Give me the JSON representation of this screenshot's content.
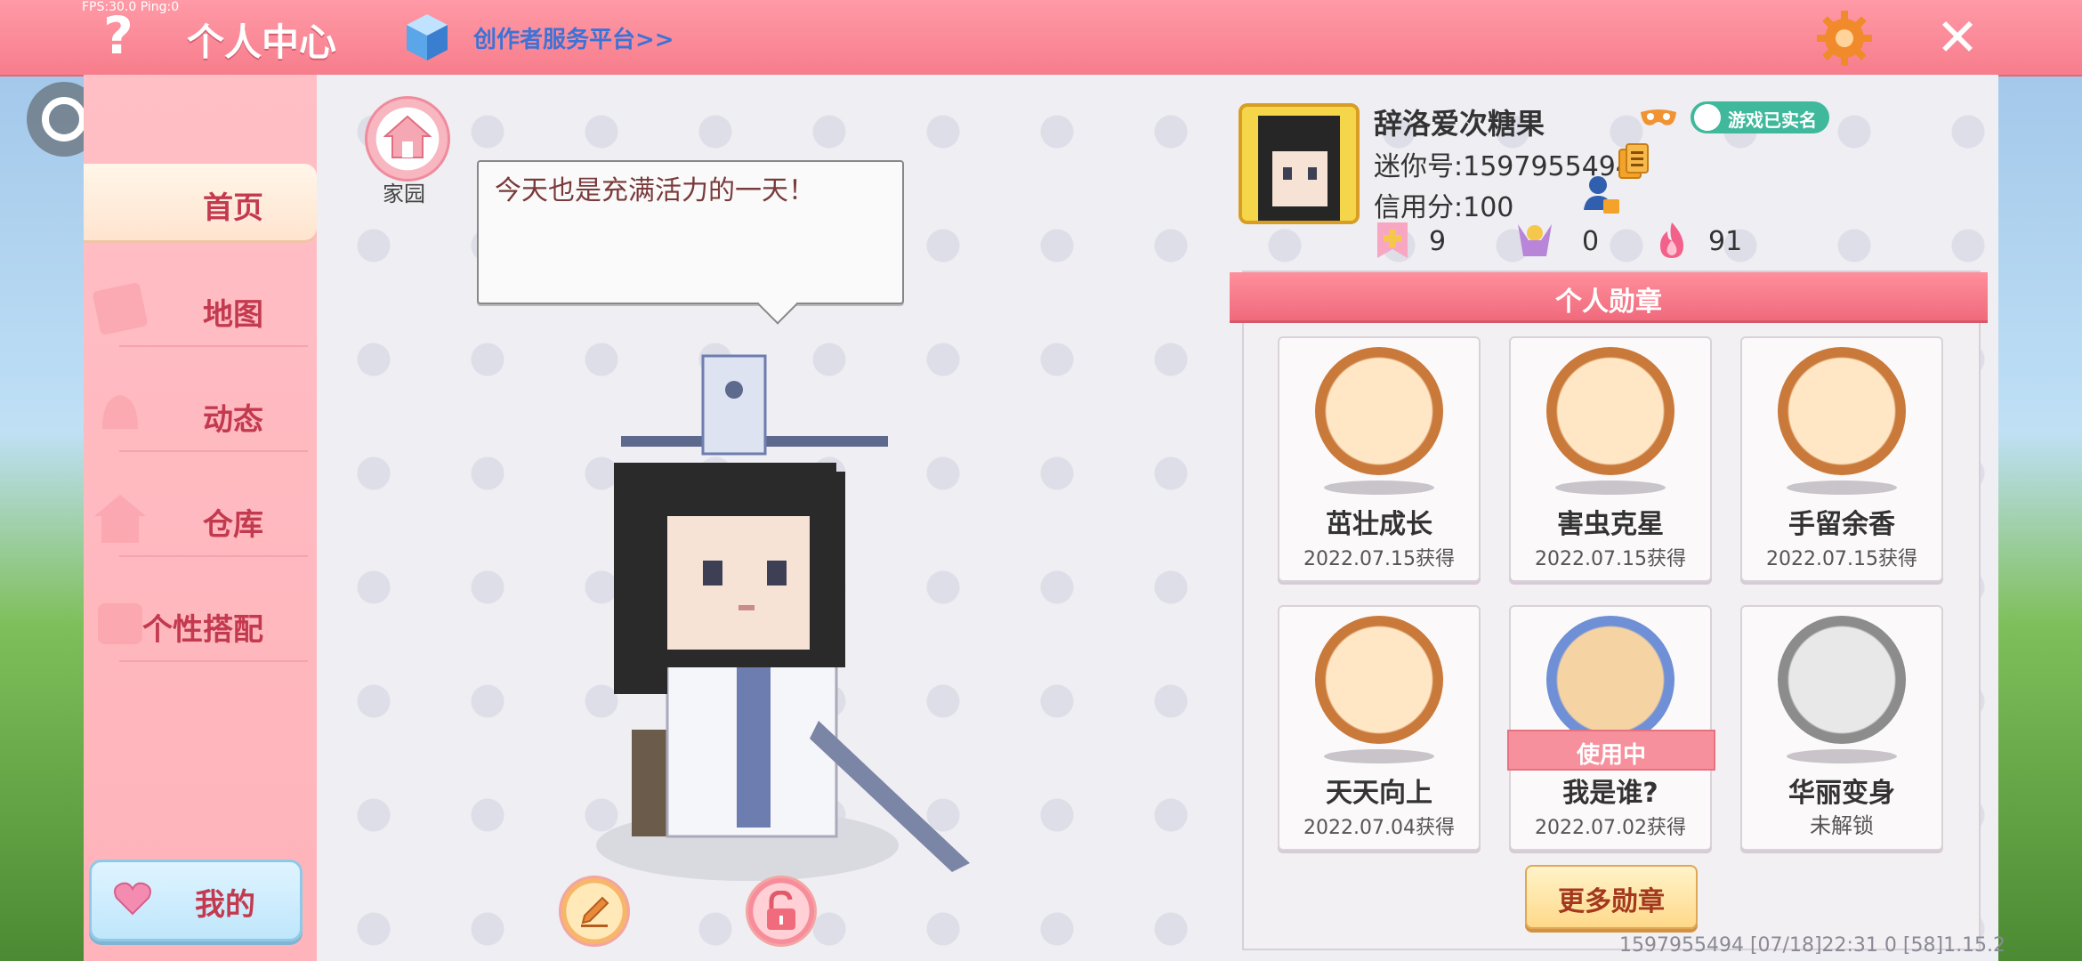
{
  "debug": {
    "fps": "FPS:30.0  Ping:0"
  },
  "header": {
    "title": "个人中心",
    "creator_link": "创作者服务平台>>"
  },
  "sidebar": {
    "items": [
      {
        "label": "首页",
        "active": true
      },
      {
        "label": "地图"
      },
      {
        "label": "动态"
      },
      {
        "label": "仓库"
      },
      {
        "label": "个性搭配"
      }
    ],
    "mine_label": "我的"
  },
  "home": {
    "label": "家园"
  },
  "speech": {
    "text": "今天也是充满活力的一天！"
  },
  "profile": {
    "nickname": "辞洛爱次糖果",
    "realname_badge": "游戏已实名",
    "uid": "迷你号:1597955494",
    "credit": "信用分:100",
    "stats": [
      {
        "icon": "plus-flag-icon",
        "value": "9"
      },
      {
        "icon": "cheer-icon",
        "value": "0"
      },
      {
        "icon": "flame-icon",
        "value": "91"
      }
    ]
  },
  "badges": {
    "title": "个人勋章",
    "items": [
      {
        "name": "茁壮成长",
        "date": "2022.07.15获得",
        "medal": "bronze"
      },
      {
        "name": "害虫克星",
        "date": "2022.07.15获得",
        "medal": "bronze"
      },
      {
        "name": "手留余香",
        "date": "2022.07.15获得",
        "medal": "bronze"
      },
      {
        "name": "天天向上",
        "date": "2022.07.04获得",
        "medal": "bronze"
      },
      {
        "name": "我是谁?",
        "date": "2022.07.02获得",
        "medal": "blue",
        "tag": "使用中"
      },
      {
        "name": "华丽变身",
        "status": "未解锁",
        "medal": "grey"
      }
    ],
    "more_label": "更多勋章"
  },
  "footer": {
    "info": "1597955494    [07/18]22:31 0    [58]1.15.2"
  }
}
